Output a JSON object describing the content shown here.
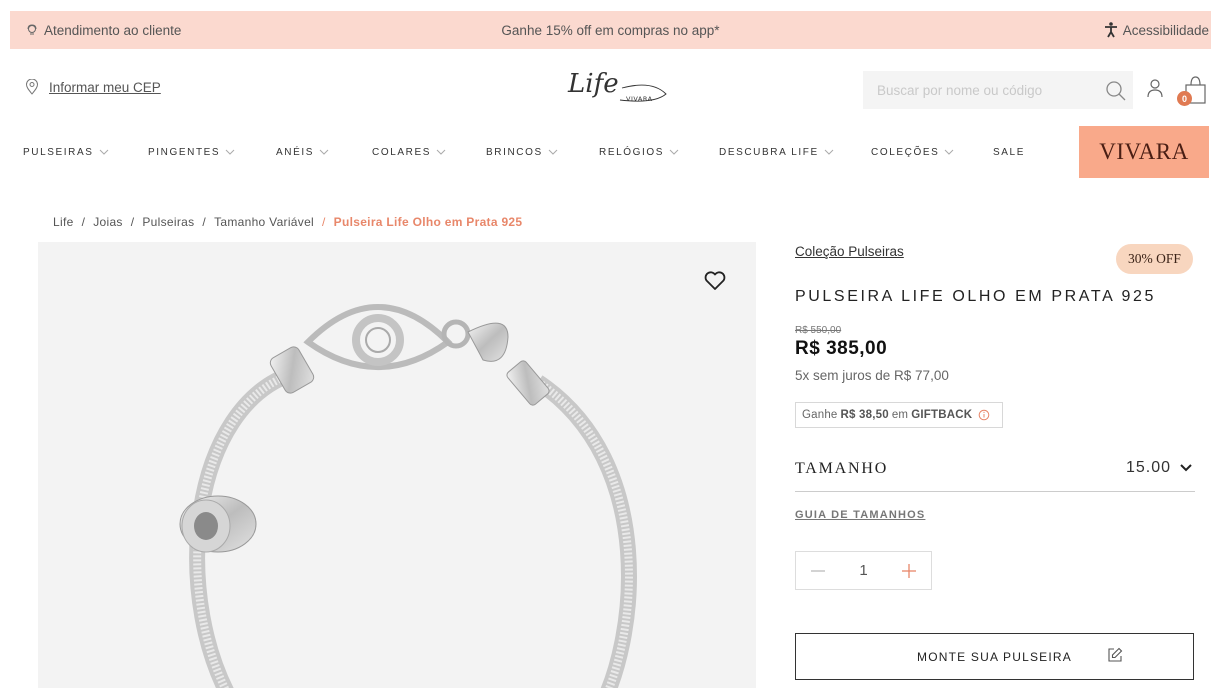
{
  "topbar": {
    "customer_service": "Atendimento ao cliente",
    "promo": "Ganhe 15% off em compras no app*",
    "accessibility": "Acessibilidade"
  },
  "header": {
    "cep_label": "Informar meu CEP",
    "logo_text": "Life",
    "logo_sub": "VIVARA",
    "search_placeholder": "Buscar por nome ou código",
    "cart_count": "0"
  },
  "nav": {
    "items": [
      {
        "label": "PULSEIRAS"
      },
      {
        "label": "PINGENTES"
      },
      {
        "label": "ANÉIS"
      },
      {
        "label": "COLARES"
      },
      {
        "label": "BRINCOS"
      },
      {
        "label": "RELÓGIOS"
      },
      {
        "label": "DESCUBRA LIFE"
      },
      {
        "label": "COLEÇÕES"
      },
      {
        "label": "SALE"
      }
    ],
    "brand": "VIVARA"
  },
  "breadcrumb": {
    "items": [
      "Life",
      "Joias",
      "Pulseiras",
      "Tamanho Variável"
    ],
    "current": "Pulseira Life Olho em Prata 925"
  },
  "product": {
    "collection": "Coleção Pulseiras",
    "discount": "30% OFF",
    "title": "PULSEIRA LIFE OLHO EM PRATA 925",
    "old_price": "R$ 550,00",
    "price": "R$ 385,00",
    "installments": "5x sem juros de R$ 77,00",
    "giftback": {
      "prefix": "Ganhe",
      "amount": "R$ 38,50",
      "middle": "em",
      "label": "GIFTBACK"
    },
    "size_label": "TAMANHO",
    "size_value": "15.00",
    "size_guide": "GUIA DE TAMANHOS",
    "quantity": "1",
    "build_button": "MONTE SUA PULSEIRA"
  },
  "colors": {
    "topbar_bg": "#fbd9cf",
    "accent": "#e8876a",
    "vivara_bg": "#f9a98a",
    "badge_bg": "#f8d6bf"
  }
}
